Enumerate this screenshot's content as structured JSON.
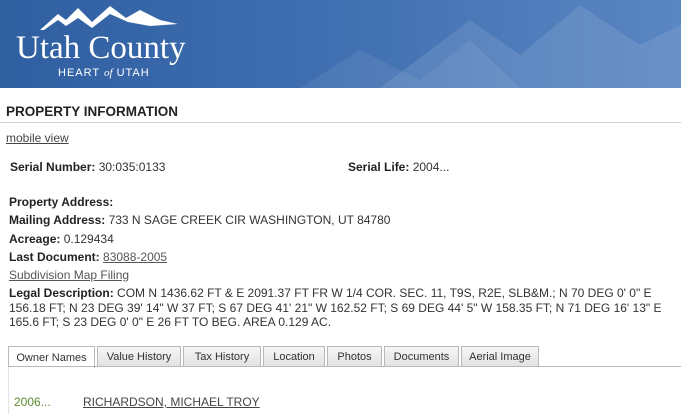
{
  "banner": {
    "title": "Utah County",
    "subtitle_left": "HEART",
    "subtitle_of": "of",
    "subtitle_right": "UTAH"
  },
  "page_title": "PROPERTY INFORMATION",
  "mobile_view_link": "mobile view",
  "serial": {
    "label": "Serial Number:",
    "value": "30:035:0133"
  },
  "serial_life": {
    "label": "Serial Life:",
    "value": "2004..."
  },
  "property_address": {
    "label": "Property Address:",
    "value": ""
  },
  "mailing_address": {
    "label": "Mailing Address:",
    "value": "733 N SAGE CREEK CIR WASHINGTON, UT 84780"
  },
  "acreage": {
    "label": "Acreage:",
    "value": "0.129434"
  },
  "last_document": {
    "label": "Last Document:",
    "value": "83088-2005"
  },
  "subdivision_link": "Subdivision Map Filing",
  "legal_description": {
    "label": "Legal Description:",
    "value": "COM N 1436.62 FT & E 2091.37 FT FR W 1/4 COR. SEC. 11, T9S, R2E, SLB&M.; N 70 DEG 0' 0\" E 156.18 FT; N 23 DEG 39' 14\" W 37 FT; S 67 DEG 41' 21\" W 162.52 FT; S 69 DEG 44' 5\" W 158.35 FT; N 71 DEG 16' 13\" E 165.6 FT; S 23 DEG 0' 0\" E 26 FT TO BEG. AREA 0.129 AC."
  },
  "tabs": [
    {
      "label": "Owner Names",
      "active": true
    },
    {
      "label": "Value History"
    },
    {
      "label": "Tax History"
    },
    {
      "label": "Location"
    },
    {
      "label": "Photos"
    },
    {
      "label": "Documents"
    },
    {
      "label": "Aerial Image"
    }
  ],
  "owners": [
    {
      "year": "2006...",
      "name": "RICHARDSON, MICHAEL TROY"
    }
  ],
  "colors": {
    "banner_blue": "#3e6eb0",
    "owner_year_green": "#5a8a2e"
  }
}
